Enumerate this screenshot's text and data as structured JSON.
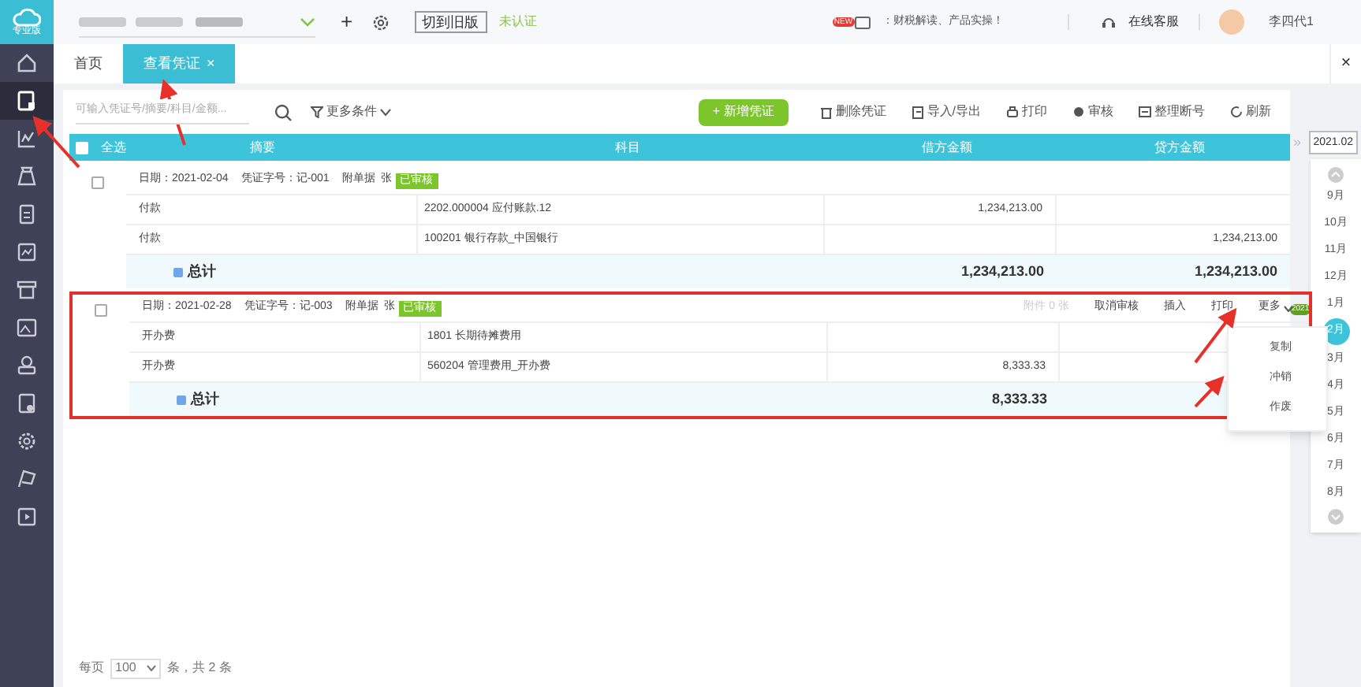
{
  "sidebar": {
    "logo_label": "专业版",
    "items": [
      {
        "selected": false
      },
      {
        "selected": true
      },
      {
        "selected": false
      },
      {
        "selected": false
      },
      {
        "selected": false
      },
      {
        "selected": false
      },
      {
        "selected": false
      },
      {
        "selected": false
      },
      {
        "selected": false
      },
      {
        "selected": false
      },
      {
        "selected": false
      },
      {
        "selected": false
      },
      {
        "selected": false
      }
    ]
  },
  "top_bar": {
    "add": "+",
    "switch_button": "切到旧版",
    "cert_status": "未认证",
    "news_badge": "NEW",
    "news": "：财税解读、产品实操！",
    "support": "在线客服",
    "user": "李四代1"
  },
  "tabs": [
    {
      "label": "首页",
      "selected": false
    },
    {
      "label": "查看凭证",
      "selected": true,
      "close": "×"
    }
  ],
  "close_all": "×",
  "toolbar": {
    "search_placeholder": "可输入凭证号/摘要/科目/金额...",
    "filter": "更多条件",
    "buttons": [
      {
        "label": "+ 新增凭证",
        "kind": "primary"
      },
      {
        "label": "删除凭证",
        "kind": "plain"
      },
      {
        "label": "导入/导出",
        "kind": "plain"
      },
      {
        "label": "打印",
        "kind": "plain"
      },
      {
        "label": "审核",
        "kind": "plain"
      },
      {
        "label": "整理断号",
        "kind": "plain"
      },
      {
        "label": "刷新",
        "kind": "plain"
      }
    ]
  },
  "table": {
    "select_all": "全选",
    "select_all_checked": false,
    "columns": [
      "摘要",
      "科目",
      "借方金额",
      "贷方金额"
    ],
    "expand": "»",
    "vouchers": [
      {
        "checked": false,
        "highlighted": false,
        "date": "日期：2021-02-04",
        "number": "凭证字号：记-001",
        "attachments": "附单据  张",
        "status": "已审核",
        "entries": [
          {
            "summary": "付款",
            "account": "2202.000004 应付账款.12",
            "debit": "1,234,213.00"
          },
          {
            "summary": "付款",
            "account": "100201 银行存款_中国银行",
            "credit": "1,234,213.00"
          }
        ],
        "total": {
          "label": "总计",
          "debit": "1,234,213.00",
          "credit": "1,234,213.00"
        }
      },
      {
        "checked": false,
        "highlighted": true,
        "date": "日期：2021-02-28",
        "number": "凭证字号：记-003",
        "attachments": "附单据  张",
        "status": "已审核",
        "actions": [
          {
            "label": "附件 0 张",
            "disabled": true
          },
          {
            "label": "取消审核",
            "disabled": false
          },
          {
            "label": "插入",
            "disabled": false
          },
          {
            "label": "打印",
            "disabled": false
          },
          {
            "label": "更多",
            "disabled": false
          }
        ],
        "menu": [
          "复制",
          "冲销",
          "作废"
        ],
        "entries": [
          {
            "summary": "开办费",
            "account": "1801 长期待摊费用"
          },
          {
            "summary": "开办费",
            "account": "560204 管理费用_开办费",
            "debit": "8,333.33"
          }
        ],
        "total": {
          "label": "总计",
          "debit": "8,333.33"
        }
      }
    ]
  },
  "period": {
    "current": "2021.02",
    "year_badge": "2021",
    "months": [
      {
        "label": "9月",
        "selected": false
      },
      {
        "label": "10月",
        "selected": false
      },
      {
        "label": "11月",
        "selected": false
      },
      {
        "label": "12月",
        "selected": false
      },
      {
        "label": "1月",
        "selected": false
      },
      {
        "label": "2月",
        "selected": true
      },
      {
        "label": "3月",
        "selected": false
      },
      {
        "label": "4月",
        "selected": false
      },
      {
        "label": "5月",
        "selected": false
      },
      {
        "label": "6月",
        "selected": false
      },
      {
        "label": "7月",
        "selected": false
      },
      {
        "label": "8月",
        "selected": false
      }
    ]
  },
  "footer": {
    "per_page_label": "每页",
    "per_page": "100",
    "total": "条，共 2 条"
  }
}
